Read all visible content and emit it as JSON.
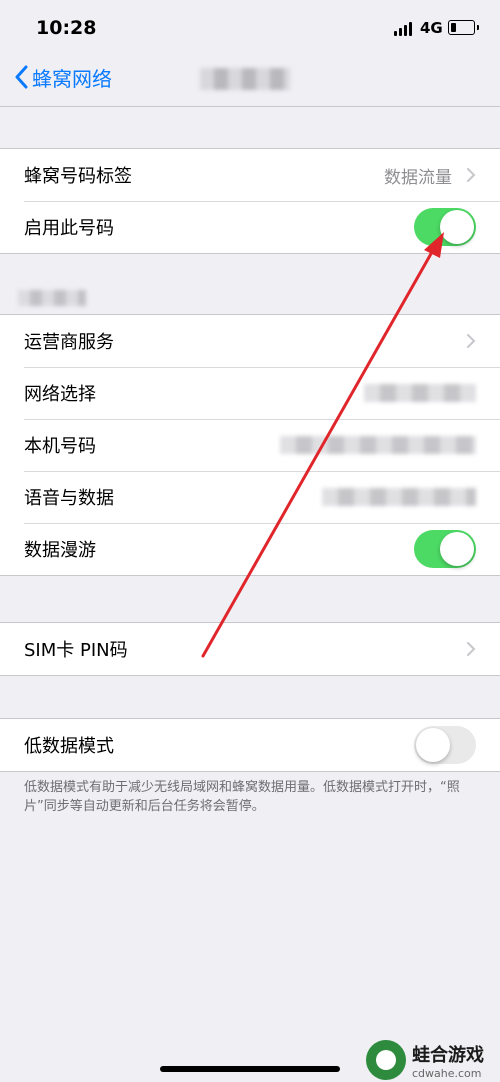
{
  "status_bar": {
    "time": "10:28",
    "network": "4G"
  },
  "nav": {
    "back_label": "蜂窝网络"
  },
  "group1": {
    "rows": [
      {
        "label": "蜂窝号码标签",
        "value": "数据流量"
      },
      {
        "label": "启用此号码",
        "switch_on": true
      }
    ]
  },
  "group2": {
    "rows": [
      {
        "label": "运营商服务"
      },
      {
        "label": "网络选择"
      },
      {
        "label": "本机号码"
      },
      {
        "label": "语音与数据"
      },
      {
        "label": "数据漫游",
        "switch_on": true
      }
    ]
  },
  "group3": {
    "rows": [
      {
        "label": "SIM卡 PIN码"
      }
    ]
  },
  "group4": {
    "rows": [
      {
        "label": "低数据模式",
        "switch_on": false
      }
    ],
    "footer": "低数据模式有助于减少无线局域网和蜂窝数据用量。低数据模式打开时，“照片”同步等自动更新和后台任务将会暂停。"
  },
  "watermark": {
    "title": "蛙合游戏",
    "subtitle": "cdwahe.com"
  },
  "colors": {
    "accent": "#0a7aff",
    "switch_on": "#4cd964",
    "switch_off": "#e9e9ea",
    "arrow": "#e0252b"
  }
}
